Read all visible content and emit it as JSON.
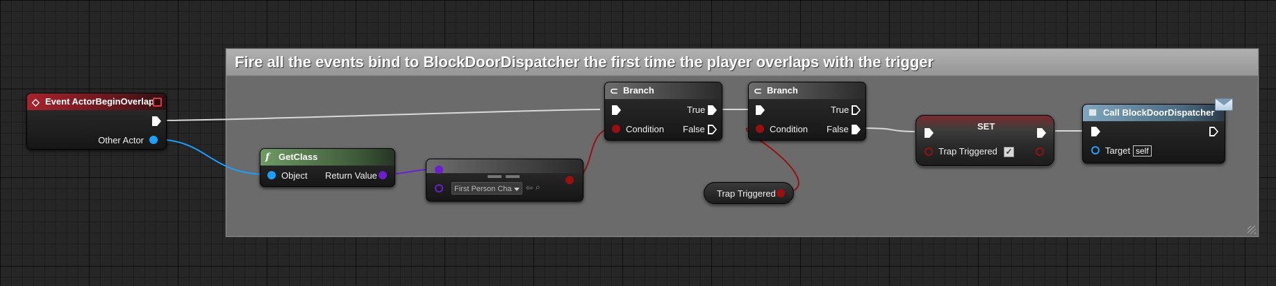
{
  "comment": {
    "title": "Fire all the events bind to BlockDoorDispatcher the first time the player overlaps with the trigger"
  },
  "nodes": {
    "event_begin_overlap": {
      "title": "Event ActorBeginOverlap",
      "icon": "event-diamond-icon",
      "pins": {
        "other_actor": "Other Actor"
      }
    },
    "get_class": {
      "title": "GetClass",
      "icon": "function-icon",
      "pins": {
        "object": "Object",
        "return_value": "Return Value"
      }
    },
    "equal_class": {
      "title": "",
      "operator_icon": "equals-icon",
      "class_value": "First Person Cha"
    },
    "branch_1": {
      "title": "Branch",
      "icon": "branch-icon",
      "pins": {
        "condition": "Condition",
        "true": "True",
        "false": "False"
      }
    },
    "branch_2": {
      "title": "Branch",
      "icon": "branch-icon",
      "pins": {
        "condition": "Condition",
        "true": "True",
        "false": "False"
      }
    },
    "trap_triggered_get": {
      "label": "Trap Triggered"
    },
    "set_node": {
      "title": "SET",
      "pins": {
        "trap_triggered": "Trap Triggered"
      },
      "checked": true
    },
    "call_dispatcher": {
      "title": "Call BlockDoorDispatcher",
      "icon": "dispatcher-icon",
      "pins": {
        "target": "Target"
      },
      "target_value": "self"
    }
  },
  "colors": {
    "exec_wire": "#d9d9d9",
    "object_wire": "#1aa0ff",
    "class_wire": "#6c1fd0",
    "bool_wire": "#9a0f0f"
  }
}
